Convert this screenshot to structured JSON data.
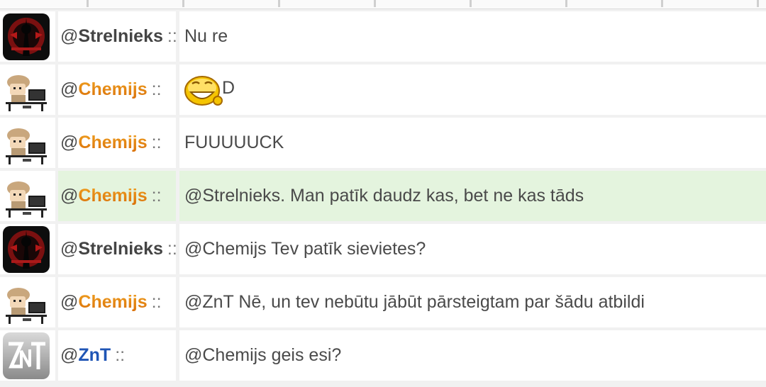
{
  "messages": [
    {
      "user": "Strelnieks",
      "at": "@",
      "sep": "::",
      "name_style": "dark",
      "avatar": "strelnieks-avatar",
      "text": "Nu re",
      "highlighted": false
    },
    {
      "user": "Chemijs",
      "at": "@",
      "sep": "::",
      "name_style": "orange",
      "avatar": "chemijs-avatar",
      "emoji": "grin-emoji",
      "text": "D",
      "highlighted": false
    },
    {
      "user": "Chemijs",
      "at": "@",
      "sep": "::",
      "name_style": "orange",
      "avatar": "chemijs-avatar",
      "text": "FUUUUUCK",
      "highlighted": false
    },
    {
      "user": "Chemijs",
      "at": "@",
      "sep": "::",
      "name_style": "orange",
      "avatar": "chemijs-avatar",
      "text": "@Strelnieks. Man patīk daudz kas, bet ne kas tāds",
      "highlighted": true
    },
    {
      "user": "Strelnieks",
      "at": "@",
      "sep": "::",
      "name_style": "dark",
      "avatar": "strelnieks-avatar",
      "text": "@Chemijs Tev patīk sievietes?",
      "highlighted": false
    },
    {
      "user": "Chemijs",
      "at": "@",
      "sep": "::",
      "name_style": "orange",
      "avatar": "chemijs-avatar",
      "text": "@ZnT Nē, un tev nebūtu jābūt pārsteigtam par šādu atbildi",
      "highlighted": false
    },
    {
      "user": "ZnT",
      "at": "@",
      "sep": "::",
      "name_style": "blue",
      "avatar": "znt-avatar",
      "text": "@Chemijs geis esi?",
      "highlighted": false
    }
  ],
  "colors": {
    "highlight": "#e4f4de",
    "chemijs_name": "#e07f10",
    "znt_name": "#1f55b5",
    "strelnieks_name": "#444444"
  }
}
